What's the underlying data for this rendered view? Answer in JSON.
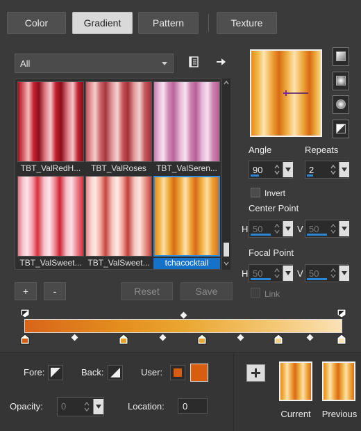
{
  "tabs": [
    {
      "label": "Color",
      "active": false
    },
    {
      "label": "Gradient",
      "active": true
    },
    {
      "label": "Pattern",
      "active": false
    },
    {
      "label": "Texture",
      "active": false
    }
  ],
  "filter": {
    "selected": "All"
  },
  "gallery": [
    {
      "label": "TBT_ValRedH...",
      "selected": false
    },
    {
      "label": "TBT_ValRoses",
      "selected": false
    },
    {
      "label": "TBT_ValSeren...",
      "selected": false
    },
    {
      "label": "TBT_ValSweet...",
      "selected": false
    },
    {
      "label": "TBT_ValSweet...",
      "selected": false
    },
    {
      "label": "tchacocktail",
      "selected": true
    }
  ],
  "buttons": {
    "add": "+",
    "remove": "-",
    "reset": "Reset",
    "save": "Save",
    "plus": "+"
  },
  "settings": {
    "angle_label": "Angle",
    "angle_value": "90",
    "repeats_label": "Repeats",
    "repeats_value": "2",
    "invert_label": "Invert",
    "center_label": "Center Point",
    "center_h": "50",
    "center_v": "50",
    "focal_label": "Focal Point",
    "focal_h": "50",
    "focal_v": "50",
    "link_label": "Link",
    "h_label": "H",
    "v_label": "V"
  },
  "bottom": {
    "fore_label": "Fore:",
    "back_label": "Back:",
    "user_label": "User:",
    "opacity_label": "Opacity:",
    "opacity_value": "0",
    "location_label": "Location:",
    "location_value": "0",
    "current_label": "Current",
    "previous_label": "Previous",
    "user_color": "#d75d10"
  },
  "colors": {
    "accent": "#1671c9"
  }
}
